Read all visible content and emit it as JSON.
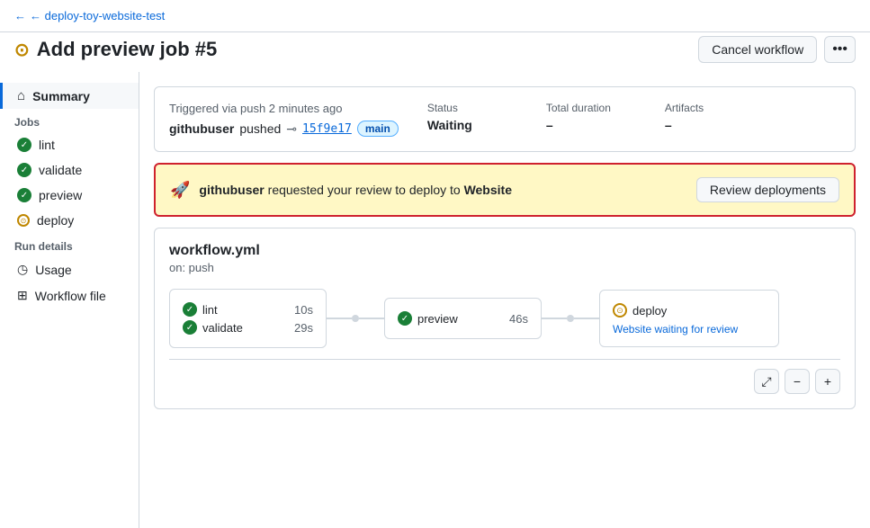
{
  "breadcrumb": {
    "back_label": "← deploy-toy-website-test"
  },
  "header": {
    "title": "Add preview job #5",
    "cancel_button": "Cancel workflow",
    "more_button": "···"
  },
  "sidebar": {
    "summary_label": "Summary",
    "jobs_section": "Jobs",
    "jobs": [
      {
        "name": "lint",
        "status": "success"
      },
      {
        "name": "validate",
        "status": "success"
      },
      {
        "name": "preview",
        "status": "success"
      },
      {
        "name": "deploy",
        "status": "waiting"
      }
    ],
    "run_details_section": "Run details",
    "run_details_items": [
      {
        "name": "Usage",
        "icon": "clock"
      },
      {
        "name": "Workflow file",
        "icon": "file"
      }
    ]
  },
  "info_card": {
    "trigger_text": "Triggered via push 2 minutes ago",
    "commit_user": "githubuser",
    "commit_action": "pushed",
    "commit_hash": "15f9e17",
    "branch": "main",
    "status_label": "Status",
    "status_value": "Waiting",
    "duration_label": "Total duration",
    "duration_value": "–",
    "artifacts_label": "Artifacts",
    "artifacts_value": "–"
  },
  "review_banner": {
    "user": "githubuser",
    "message_pre": "requested your review to deploy to",
    "environment": "Website",
    "button_label": "Review deployments"
  },
  "workflow_card": {
    "title": "workflow.yml",
    "trigger": "on: push",
    "jobs": [
      {
        "name": "lint",
        "time": "10s",
        "status": "success",
        "sub_jobs": [
          {
            "name": "validate",
            "time": "29s",
            "status": "success"
          }
        ]
      },
      {
        "name": "preview",
        "time": "46s",
        "status": "success"
      },
      {
        "name": "deploy",
        "time": "",
        "status": "waiting",
        "waiting_label": "Website waiting for review"
      }
    ],
    "footer_icons": [
      "expand",
      "minus",
      "plus"
    ]
  }
}
